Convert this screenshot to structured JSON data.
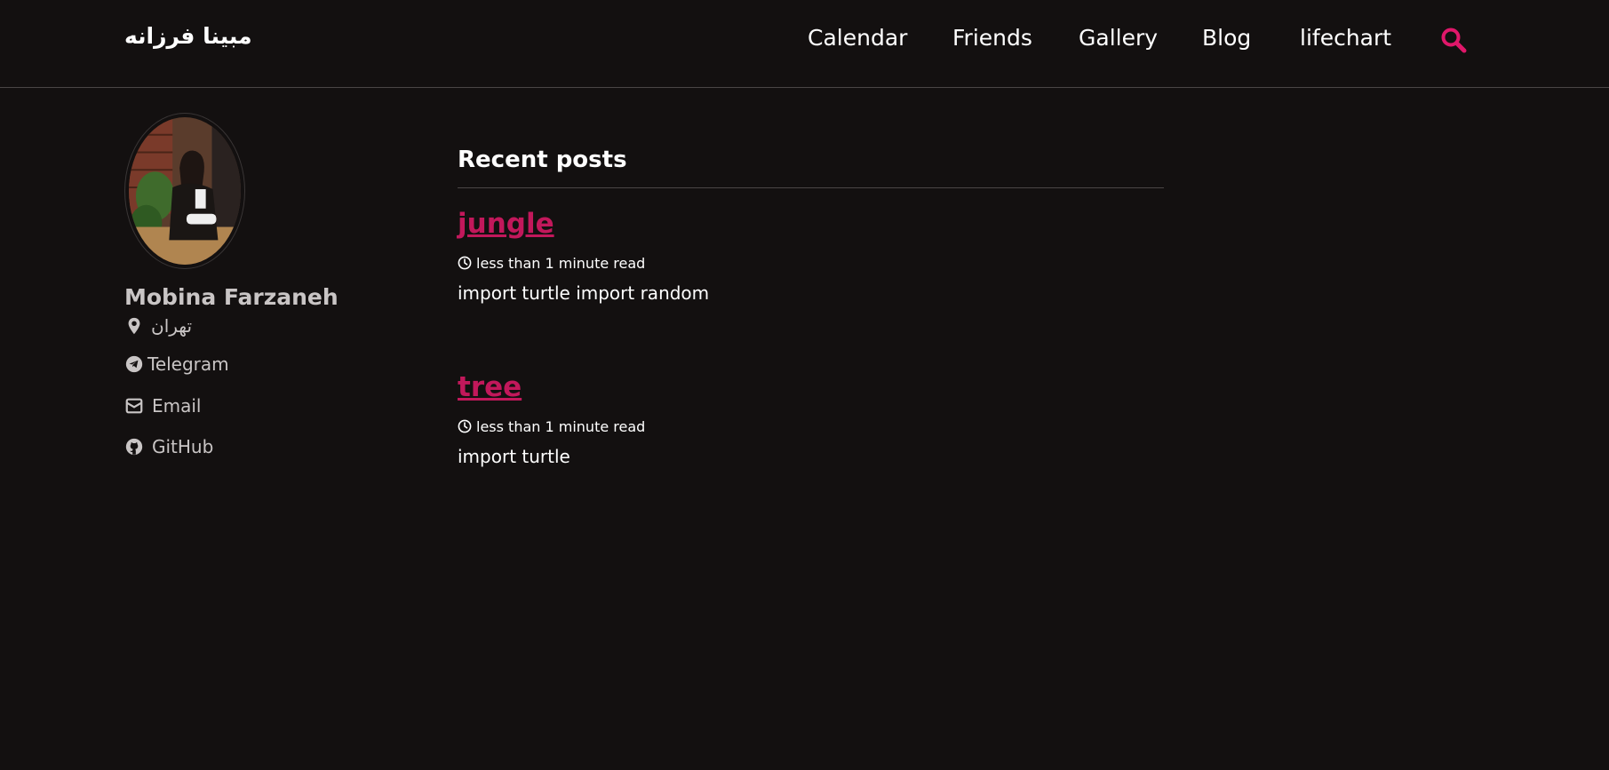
{
  "site": {
    "title": "مبینا فرزانه"
  },
  "nav": {
    "items": [
      {
        "label": "Calendar"
      },
      {
        "label": "Friends"
      },
      {
        "label": "Gallery"
      },
      {
        "label": "Blog"
      },
      {
        "label": "lifechart"
      }
    ],
    "search_icon": "search-icon"
  },
  "author": {
    "name": "Mobina Farzaneh",
    "location": "تهران",
    "links": [
      {
        "label": "Telegram",
        "icon": "telegram-icon"
      },
      {
        "label": "Email",
        "icon": "envelope-icon"
      },
      {
        "label": "GitHub",
        "icon": "github-icon"
      }
    ]
  },
  "main": {
    "section_title": "Recent posts",
    "posts": [
      {
        "title": "jungle",
        "read_time": "less than 1 minute read",
        "excerpt": "import turtle import random"
      },
      {
        "title": "tree",
        "read_time": "less than 1 minute read",
        "excerpt": "import turtle"
      }
    ]
  },
  "colors": {
    "background": "#131010",
    "accent": "#c2185b",
    "search_accent": "#e0176a",
    "text": "#ffffff",
    "muted_text": "#c9c5c5"
  }
}
